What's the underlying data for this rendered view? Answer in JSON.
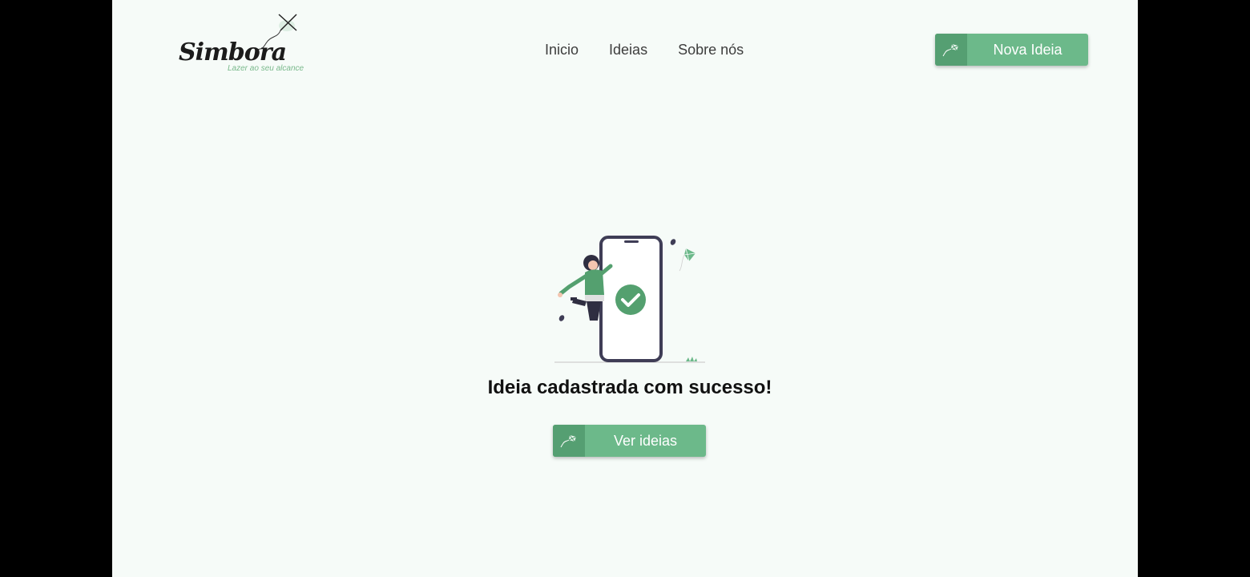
{
  "logo": {
    "brand": "Simbora",
    "tagline": "Lazer ao seu alcance"
  },
  "nav": {
    "items": [
      {
        "label": "Inicio"
      },
      {
        "label": "Ideias"
      },
      {
        "label": "Sobre nós"
      }
    ]
  },
  "header_button": {
    "label": "Nova Ideia",
    "icon": "kite-icon"
  },
  "main": {
    "illustration": "phone-success-illustration",
    "message": "Ideia cadastrada com sucesso!",
    "cta_label": "Ver ideias",
    "cta_icon": "kite-icon"
  },
  "colors": {
    "page_background": "#f6fbf8",
    "accent": "#6cb98a",
    "accent_dark": "#559f72",
    "frame": "#000000"
  }
}
